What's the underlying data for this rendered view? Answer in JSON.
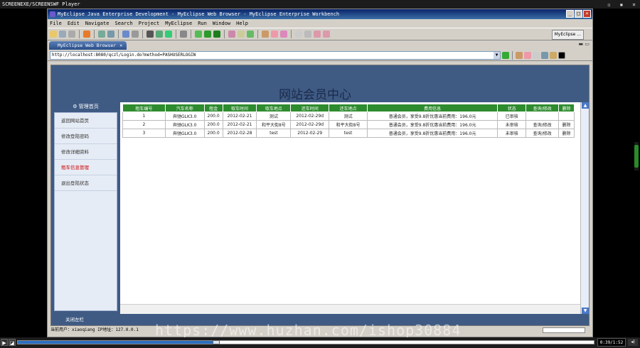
{
  "player": {
    "title": "SCREENEXE/SCREENSWF Player",
    "controls": "▫ ▪ ×",
    "time": "0:39/1:52",
    "progress_fraction": 0.345
  },
  "eclipse": {
    "title": "MyEclipse Java Enterprise Development - MyEclipse Web Browser - MyEclipse Enterprise Workbench",
    "menu": [
      "File",
      "Edit",
      "Navigate",
      "Search",
      "Project",
      "MyEclipse",
      "Run",
      "Window",
      "Help"
    ],
    "perspective": "MyEclipse ...",
    "tab_label": "MyEclipse Web Browser",
    "url": "http://localhost:8080/qczl/Login.do?method=PASHUSERLOGIN",
    "status": "当前用户：xiaoqiang  IP地址：127.0.0.1"
  },
  "site": {
    "title": "网站会员中心",
    "sidebar_head": "管理首页",
    "sidebar_items": [
      "返回网站首页",
      "修改登陆密码",
      "修改详细资料",
      "租车信息管理",
      "退出登陆状态"
    ],
    "active_index": 3,
    "close_link": "关闭左栏"
  },
  "table": {
    "headers": [
      "租车编号",
      "汽车名称",
      "租金",
      "取车时间",
      "取车地点",
      "还车时间",
      "还车地点",
      "费用信息",
      "状态",
      "查询/修改",
      "删除"
    ],
    "rows": [
      [
        "1",
        "奔驰GLK3.0",
        "200.0",
        "2012-02-21",
        "测试",
        "2012-02-29d",
        "测试",
        "普通会员，享受9.8折优惠当前费用：196.0元",
        "已审核",
        "",
        ""
      ],
      [
        "2",
        "奔驰GLK3.0",
        "200.0",
        "2012-02-21",
        "和平大街8号",
        "2012-02-29d",
        "和平大街8号",
        "普通会员，享受9.8折优惠当前费用：196.0元",
        "未审核",
        "查询/修改",
        "删除"
      ],
      [
        "3",
        "奔驰GLK3.0",
        "200.0",
        "2012-02-28",
        "test",
        "2012-02-29",
        "test",
        "普通会员，享受9.8折优惠当前费用：196.0元",
        "未审核",
        "查询/修改",
        "删除"
      ]
    ]
  },
  "watermark": "https://www.huzhan.com/ishop30884",
  "colors": {
    "header_green": "#2e8b2e",
    "site_blue": "#3f5b84",
    "active_red": "#c00000"
  }
}
